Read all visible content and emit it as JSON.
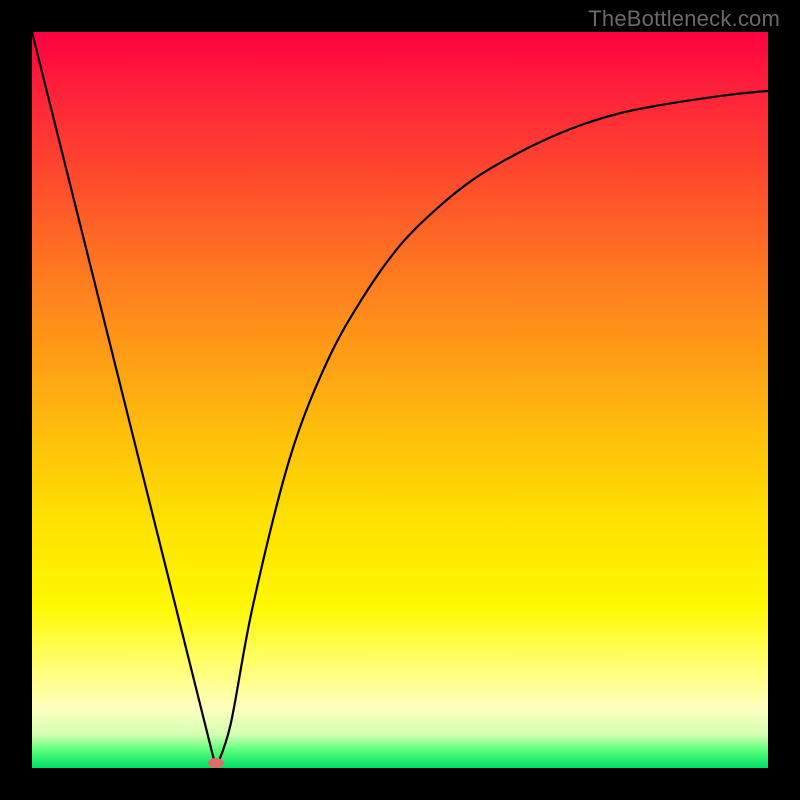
{
  "watermark": "TheBottleneck.com",
  "chart_data": {
    "type": "line",
    "title": "",
    "xlabel": "",
    "ylabel": "",
    "xlim": [
      0,
      100
    ],
    "ylim": [
      0,
      100
    ],
    "series": [
      {
        "name": "bottleneck-curve",
        "x": [
          0,
          5,
          10,
          15,
          20,
          22.5,
          25,
          27,
          30,
          35,
          40,
          45,
          50,
          55,
          60,
          65,
          70,
          75,
          80,
          85,
          90,
          95,
          100
        ],
        "values": [
          100,
          80,
          60,
          40,
          20,
          10,
          0,
          6,
          22,
          42,
          55,
          64,
          71,
          76,
          80,
          83,
          85.5,
          87.5,
          89,
          90,
          90.8,
          91.5,
          92
        ]
      },
      {
        "name": "marker",
        "x": [
          25
        ],
        "values": [
          0
        ]
      }
    ],
    "gradient_stops": [
      {
        "pos": 0.0,
        "color": "#ff0040"
      },
      {
        "pos": 0.06,
        "color": "#ff1a3c"
      },
      {
        "pos": 0.17,
        "color": "#ff4030"
      },
      {
        "pos": 0.33,
        "color": "#ff7a20"
      },
      {
        "pos": 0.5,
        "color": "#ffb010"
      },
      {
        "pos": 0.66,
        "color": "#ffe000"
      },
      {
        "pos": 0.78,
        "color": "#fff800"
      },
      {
        "pos": 0.86,
        "color": "#ffff70"
      },
      {
        "pos": 0.92,
        "color": "#ffffc0"
      },
      {
        "pos": 0.955,
        "color": "#d0ffb0"
      },
      {
        "pos": 0.975,
        "color": "#60ff80"
      },
      {
        "pos": 1.0,
        "color": "#00e060"
      }
    ],
    "marker_color": "#e16b6b"
  }
}
